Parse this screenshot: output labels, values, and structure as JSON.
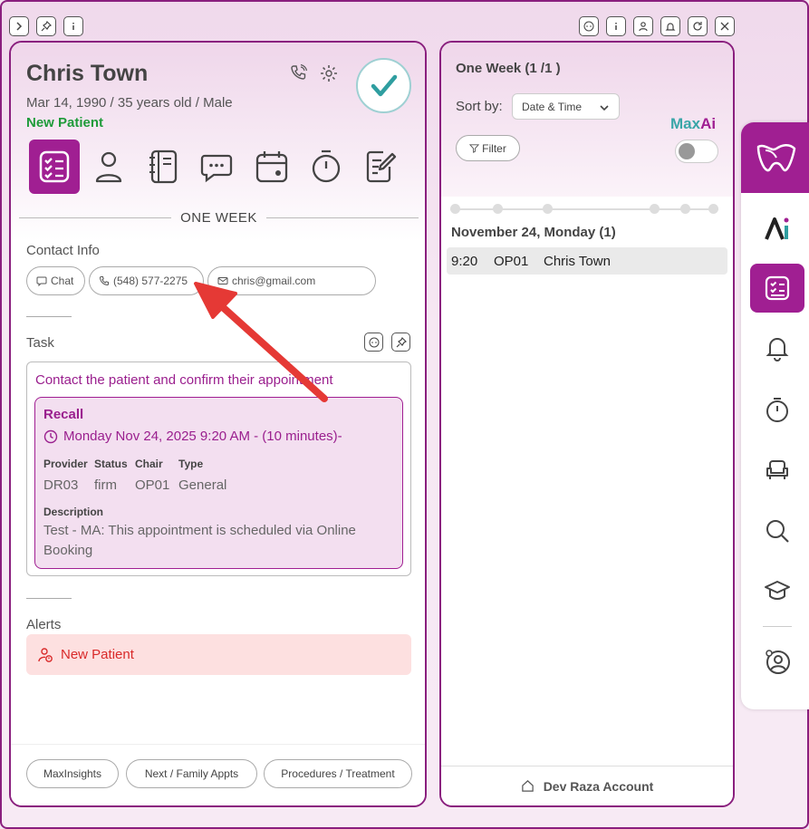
{
  "topbar": {
    "left_icons": [
      "chevron-right-icon",
      "pin-icon",
      "info-icon"
    ],
    "right_icons": [
      "robot-icon",
      "info-icon",
      "user-icon",
      "bell-icon",
      "refresh-icon",
      "close-icon"
    ]
  },
  "patient": {
    "name": "Chris Town",
    "info": "Mar 14, 1990 / 35 years old / Male",
    "status": "New Patient"
  },
  "nav_icons": [
    "checklist-icon",
    "person-icon",
    "notebook-icon",
    "chat-icon",
    "calendar-icon",
    "timer-icon",
    "notes-edit-icon"
  ],
  "section_title": "ONE WEEK",
  "contact": {
    "label": "Contact Info",
    "chat": "Chat",
    "phone": "(548) 577-2275",
    "email": "chris@gmail.com"
  },
  "task": {
    "label": "Task",
    "text": "Contact the patient and confirm their appointment",
    "recall": {
      "title": "Recall",
      "time": "Monday Nov 24, 2025 9:20 AM - (10 minutes)-",
      "headers": [
        "Provider",
        "Status",
        "Chair",
        "Type"
      ],
      "values": [
        "DR03",
        "firm",
        "OP01",
        "General"
      ],
      "desc_label": "Description",
      "description": "Test - MA: This appointment is scheduled via Online Booking"
    }
  },
  "alerts": {
    "label": "Alerts",
    "item": "New Patient"
  },
  "footer_buttons": [
    "MaxInsights",
    "Next / Family Appts",
    "Procedures / Treatment"
  ],
  "right_panel": {
    "title": "One Week (1 /1 )",
    "sort_label": "Sort by:",
    "sort_value": "Date & Time",
    "maxai_max": "Max",
    "maxai_ai": "Ai",
    "filter": "Filter",
    "toggle_on": false,
    "day_header": "November 24, Monday (1)",
    "appointment": {
      "time": "9:20",
      "chair": "OP01",
      "patient": "Chris Town"
    },
    "footer": "Dev Raza Account"
  },
  "sidebar_icons": [
    "tooth-logo-icon",
    "ai-logo-icon",
    "checklist-icon",
    "bell-icon",
    "timer-icon",
    "chair-icon",
    "search-icon",
    "graduation-cap-icon",
    "user-settings-icon"
  ],
  "colors": {
    "accent": "#a01f92",
    "green": "#1f9b3a",
    "alert": "#d92a2a",
    "teal": "#3aa6a8",
    "arrow": "#e53935"
  }
}
